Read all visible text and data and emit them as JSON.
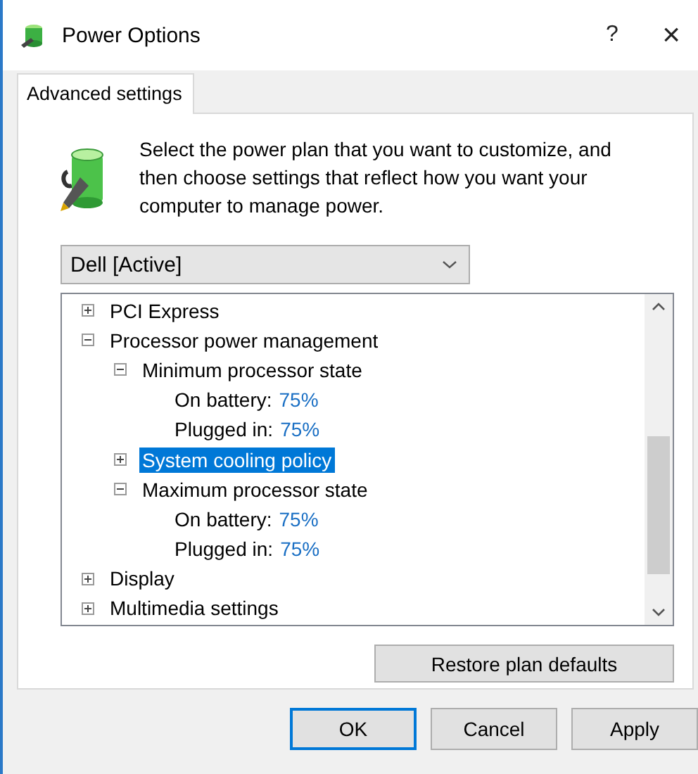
{
  "window": {
    "title": "Power Options",
    "help": "?",
    "close": "×"
  },
  "tabs": [
    {
      "label": "Advanced settings",
      "selected": true
    }
  ],
  "description": "Select the power plan that you want to customize, and then choose settings that reflect how you want your computer to manage power.",
  "plan_dropdown": {
    "value": "Dell [Active]"
  },
  "tree": [
    {
      "kind": "group",
      "label": "PCI Express",
      "expanded": false,
      "selected": false
    },
    {
      "kind": "group",
      "label": "Processor power management",
      "expanded": true,
      "selected": false,
      "children": [
        {
          "kind": "group",
          "label": "Minimum processor state",
          "expanded": true,
          "selected": false,
          "children": [
            {
              "kind": "setting",
              "label": "On battery:",
              "value": "75%",
              "selected": false
            },
            {
              "kind": "setting",
              "label": "Plugged in:",
              "value": "75%",
              "selected": false
            }
          ]
        },
        {
          "kind": "group",
          "label": "System cooling policy",
          "expanded": false,
          "selected": true
        },
        {
          "kind": "group",
          "label": "Maximum processor state",
          "expanded": true,
          "selected": false,
          "children": [
            {
              "kind": "setting",
              "label": "On battery:",
              "value": "75%",
              "selected": false
            },
            {
              "kind": "setting",
              "label": "Plugged in:",
              "value": "75%",
              "selected": false
            }
          ]
        }
      ]
    },
    {
      "kind": "group",
      "label": "Display",
      "expanded": false,
      "selected": false
    },
    {
      "kind": "group",
      "label": "Multimedia settings",
      "expanded": false,
      "selected": false
    }
  ],
  "restore_button": "Restore plan defaults",
  "buttons": [
    {
      "label": "OK",
      "default": true
    },
    {
      "label": "Cancel",
      "default": false
    },
    {
      "label": "Apply",
      "default": false
    }
  ]
}
